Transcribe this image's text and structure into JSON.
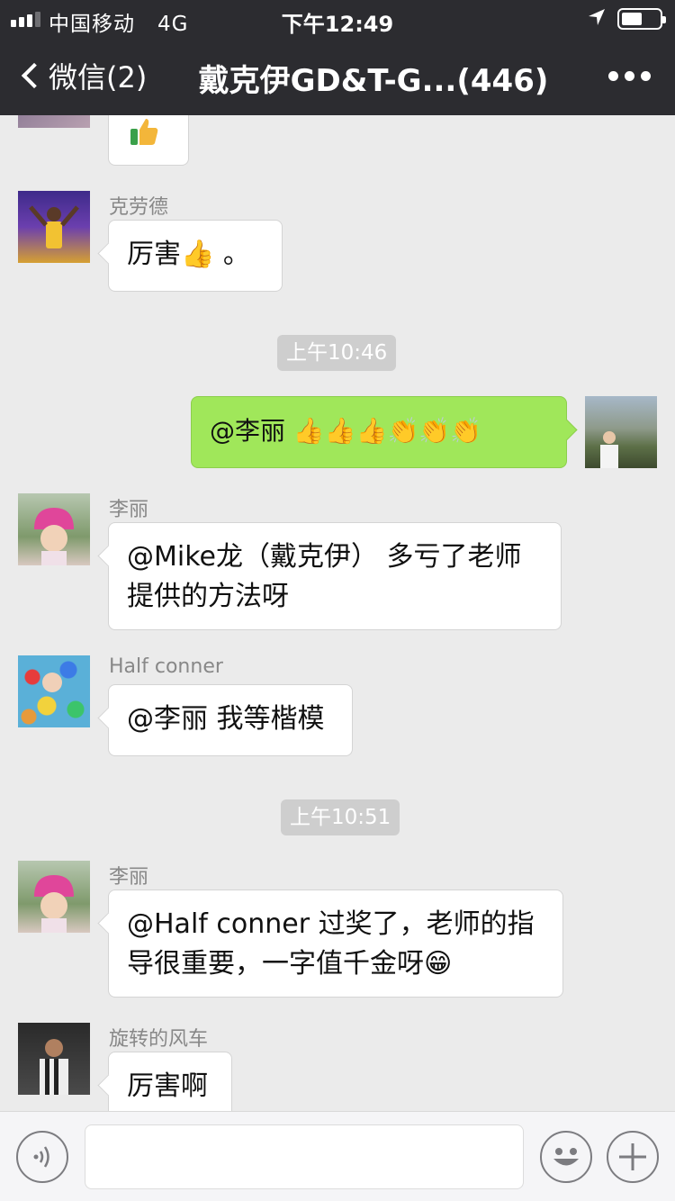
{
  "status_bar": {
    "carrier": "中国移动",
    "network": "4G",
    "time": "下午12:49"
  },
  "nav": {
    "back_label": "微信(2)",
    "title": "戴克伊GD&T-G...(446)"
  },
  "messages": {
    "m1": {
      "text": "厉害👍 。",
      "sender": "克劳德"
    },
    "t1": "上午10:46",
    "m2": {
      "text": "@李丽 👍👍👍👏👏👏"
    },
    "m3": {
      "sender": "李丽",
      "line1": "@Mike龙（戴克伊） 多亏了老师",
      "line2": "提供的方法呀"
    },
    "m4": {
      "sender": "Half conner",
      "text": "@李丽 我等楷模"
    },
    "t2": "上午10:51",
    "m5": {
      "sender": "李丽",
      "line1": "@Half conner 过奖了，老师的指",
      "line2": "导很重要，一字值千金呀😁"
    },
    "m6": {
      "sender": "旋转的风车",
      "text": "厉害啊"
    }
  },
  "icons": [
    "signal-icon",
    "location-icon",
    "battery-icon",
    "back-chevron-icon",
    "more-icon",
    "voice-icon",
    "emoji-icon",
    "plus-icon",
    "thumbs-up-icon"
  ],
  "colors": {
    "nav_bg": "#2c2c30",
    "chat_bg": "#ebebeb",
    "sent_bubble": "#a0e75a",
    "received_bubble": "#ffffff"
  }
}
